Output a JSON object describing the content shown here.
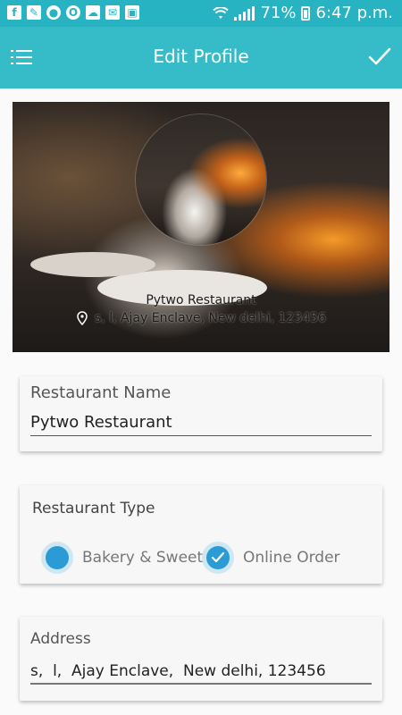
{
  "statusbar": {
    "battery": "71%",
    "time": "6:47 p.m.",
    "left_icons": [
      "facebook-icon",
      "wrench-icon",
      "app-icon",
      "opera-icon",
      "cloud-icon",
      "mail-icon",
      "screen-icon"
    ]
  },
  "appbar": {
    "title": "Edit Profile"
  },
  "banner": {
    "restaurant_name": "Pytwo Restaurant",
    "address": "s,  l,  Ajay Enclave,  New delhi, 123456"
  },
  "form": {
    "name_label": "Restaurant Name",
    "name_value": "Pytwo Restaurant",
    "type_label": "Restaurant Type",
    "type_options": [
      {
        "label": "Bakery & Sweets",
        "checked": false
      },
      {
        "label": "Online Order",
        "checked": true
      }
    ],
    "address_label": "Address",
    "address_value": "s,  l,  Ajay Enclave,  New delhi, 123456"
  },
  "colors": {
    "statusbar": "#27b3c1",
    "appbar": "#36bcc9",
    "radio": "#2a9bd4"
  }
}
